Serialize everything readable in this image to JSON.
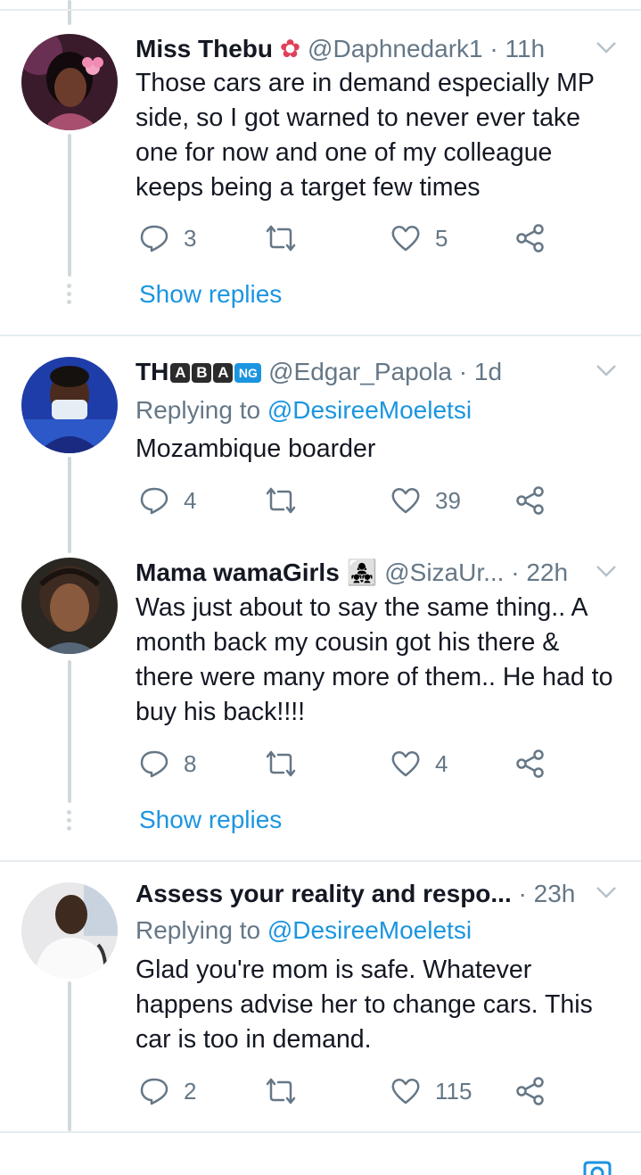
{
  "tweets": [
    {
      "name": "Miss Thebu",
      "handle": "@Daphnedark1",
      "dot": "·",
      "time": "11h",
      "reply_prefix": "",
      "reply_mention": "",
      "text": "Those cars are in demand especially MP side, so I got warned to never ever take one for now and one of my colleague keeps being a target few times",
      "replies": "3",
      "retweets": "",
      "likes": "5",
      "show_replies": "Show replies",
      "avatar_icon": "woman-with-flower-avatar"
    },
    {
      "name_prefix": "TH",
      "name_badges": [
        "A",
        "B",
        "A",
        "NG"
      ],
      "handle": "@Edgar_Papola",
      "dot": "·",
      "time": "1d",
      "reply_prefix": "Replying to ",
      "reply_mention": "@DesireeMoeletsi",
      "text": "Mozambique boarder",
      "replies": "4",
      "retweets": "",
      "likes": "39",
      "avatar_icon": "man-with-mask-avatar"
    },
    {
      "name": "Mama wamaGirls",
      "handle": "@SizaUr...",
      "dot": "·",
      "time": "22h",
      "text": "Was just about to say the same thing.. A month back my cousin got his there & there were many more of them.. He had to buy his back!!!!",
      "replies": "8",
      "retweets": "",
      "likes": "4",
      "show_replies": "Show replies",
      "avatar_icon": "woman-braids-avatar"
    },
    {
      "name": "Assess your reality and respo...",
      "dot": "·",
      "time": "23h",
      "reply_prefix": "Replying to ",
      "reply_mention": "@DesireeMoeletsi",
      "text": "Glad you're mom is safe. Whatever happens advise her to change cars. This car is too in demand.",
      "replies": "2",
      "retweets": "",
      "likes": "115",
      "avatar_icon": "man-white-shirt-avatar"
    }
  ],
  "colors": {
    "text": "#141823",
    "secondary": "#657786",
    "link": "#1b95e0",
    "thread_line": "#cfd9de",
    "divider": "#e6ecf0"
  },
  "icons": {
    "reply": "reply-icon",
    "retweet": "retweet-icon",
    "like": "heart-icon",
    "share": "share-icon",
    "more": "chevron-down-icon"
  }
}
